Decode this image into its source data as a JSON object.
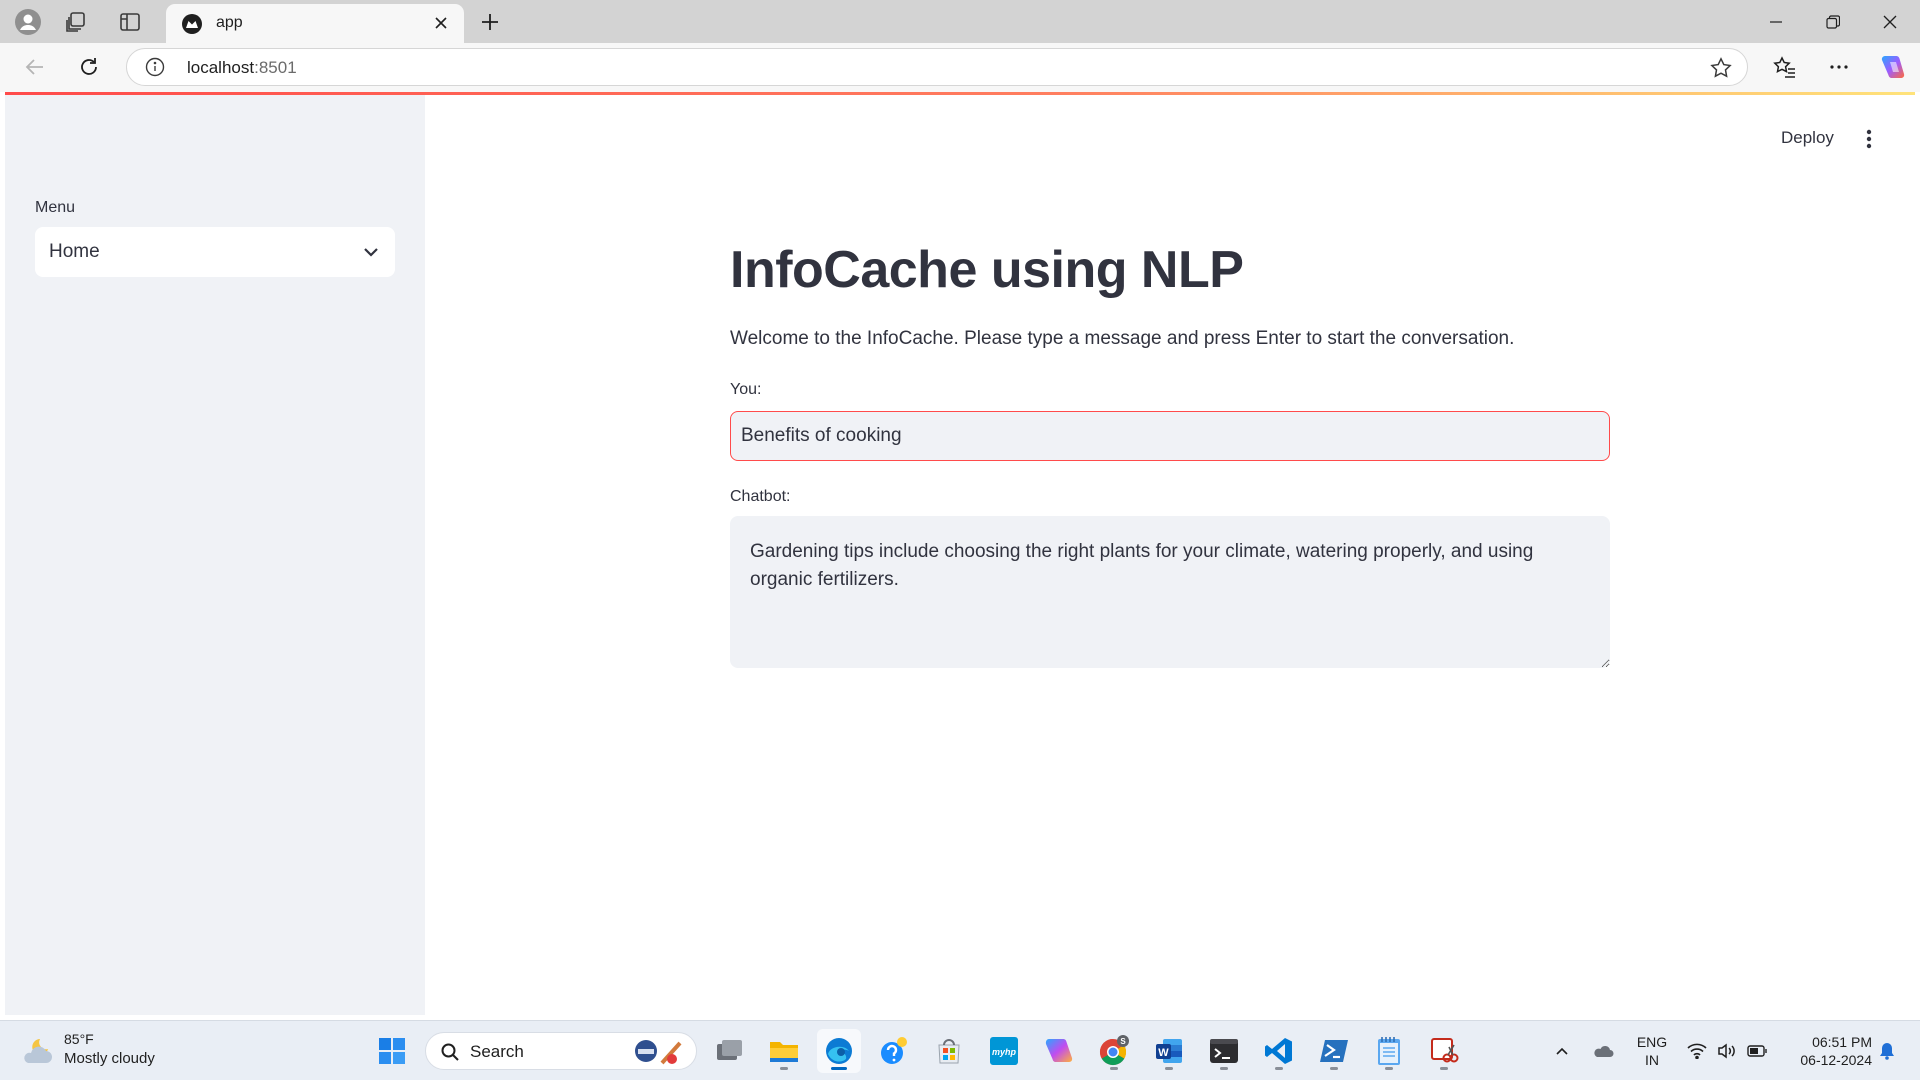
{
  "browser": {
    "tab_title": "app",
    "url_host": "localhost",
    "url_port": ":8501"
  },
  "sidebar": {
    "menu_label": "Menu",
    "menu_selected": "Home"
  },
  "header": {
    "deploy_label": "Deploy"
  },
  "main": {
    "title": "InfoCache using NLP",
    "welcome": "Welcome to the InfoCache. Please type a message and press Enter to start the conversation.",
    "you_label": "You:",
    "you_value": "Benefits of cooking",
    "chatbot_label": "Chatbot:",
    "chatbot_value": "Gardening tips include choosing the right plants for your climate, watering properly, and using organic fertilizers."
  },
  "taskbar": {
    "weather_temp": "85°F",
    "weather_desc": "Mostly cloudy",
    "search_placeholder": "Search",
    "chrome_badge": "S",
    "lang_line1": "ENG",
    "lang_line2": "IN",
    "time": "06:51 PM",
    "date": "06-12-2024"
  },
  "colors": {
    "accent": "#ff4b4b",
    "sidebar_bg": "#f0f2f6",
    "text": "#31333f",
    "taskbar_bg": "#e9eef5"
  }
}
